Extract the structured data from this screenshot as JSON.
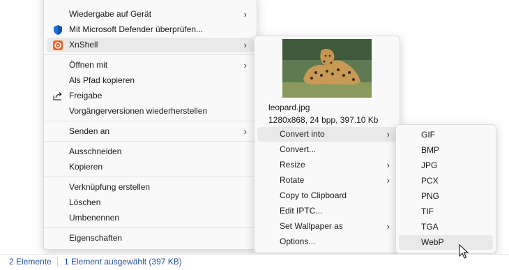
{
  "main_menu": {
    "items": [
      {
        "label": "Wiedergabe auf Gerät",
        "has_submenu": true
      },
      {
        "label": "Mit Microsoft Defender überprüfen...",
        "icon": "defender-shield-icon"
      },
      {
        "label": "XnShell",
        "icon": "xnshell-icon",
        "has_submenu": true,
        "highlighted": true
      },
      {
        "label": "Öffnen mit",
        "has_submenu": true
      },
      {
        "label": "Als Pfad kopieren"
      },
      {
        "label": "Freigabe",
        "icon": "share-icon"
      },
      {
        "label": "Vorgängerversionen wiederherstellen"
      },
      {
        "label": "Senden an",
        "has_submenu": true
      },
      {
        "label": "Ausschneiden"
      },
      {
        "label": "Kopieren"
      },
      {
        "label": "Verknüpfung erstellen"
      },
      {
        "label": "Löschen"
      },
      {
        "label": "Umbenennen"
      },
      {
        "label": "Eigenschaften"
      }
    ]
  },
  "xnshell": {
    "file_name": "leopard.jpg",
    "file_info": "1280x868, 24 bpp, 397.10 Kb",
    "items": [
      {
        "label": "Convert into",
        "has_submenu": true,
        "highlighted": true
      },
      {
        "label": "Convert..."
      },
      {
        "label": "Resize",
        "has_submenu": true
      },
      {
        "label": "Rotate",
        "has_submenu": true
      },
      {
        "label": "Copy to Clipboard"
      },
      {
        "label": "Edit IPTC..."
      },
      {
        "label": "Set Wallpaper as",
        "has_submenu": true
      },
      {
        "label": "Options..."
      }
    ]
  },
  "convert_into": {
    "items": [
      {
        "label": "GIF"
      },
      {
        "label": "BMP"
      },
      {
        "label": "JPG"
      },
      {
        "label": "PCX"
      },
      {
        "label": "PNG"
      },
      {
        "label": "TIF"
      },
      {
        "label": "TGA"
      },
      {
        "label": "WebP",
        "highlighted": true
      }
    ]
  },
  "status_bar": {
    "count": "2 Elemente",
    "selection": "1 Element ausgewählt (397 KB)"
  },
  "colors": {
    "defender_blue": "#1f6fd1",
    "xnshell_orange": "#e8622a",
    "status_text": "#1f4e9a",
    "highlight": "#e9e9e9"
  }
}
